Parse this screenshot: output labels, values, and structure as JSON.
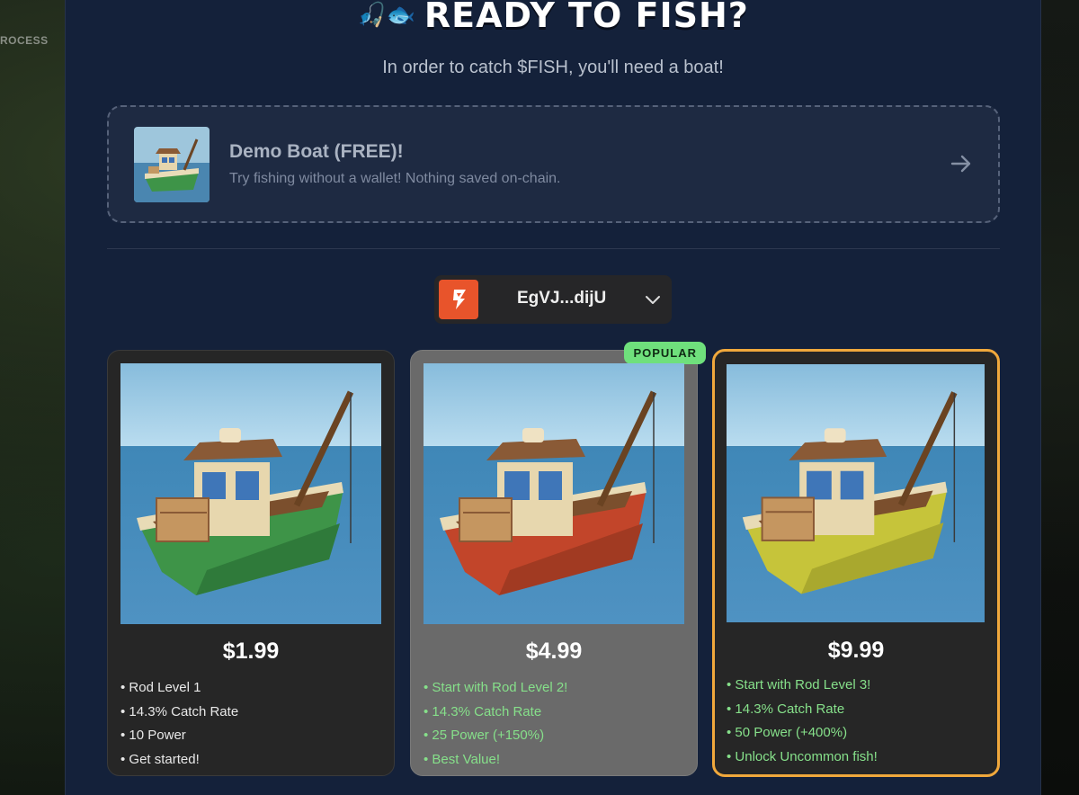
{
  "background": {
    "label": "ROCESS"
  },
  "modal": {
    "title": "READY TO FISH?",
    "title_emoji": "🎣🐟",
    "subtitle": "In order to catch $FISH, you'll need a boat!"
  },
  "demo": {
    "title": "Demo Boat (FREE)!",
    "subtitle": "Try fishing without a wallet! Nothing saved on-chain.",
    "arrow_icon": "arrow-right-icon"
  },
  "wallet": {
    "address": "EgVJ...dijU",
    "logo_icon": "wallet-logo-icon",
    "chevron_icon": "chevron-down-icon"
  },
  "colors": {
    "modal_bg": "#14213a",
    "accent_orange": "#f0a83c",
    "popular_green": "#6fe07c",
    "feature_green": "#86e08a"
  },
  "plans": [
    {
      "price": "$1.99",
      "boat_color": "green",
      "features": [
        "• Rod Level 1",
        "• 14.3% Catch Rate",
        "• 10 Power",
        "• Get started!"
      ]
    },
    {
      "price": "$4.99",
      "badge": "POPULAR",
      "boat_color": "red",
      "features": [
        "• Start with Rod Level 2!",
        "• 14.3% Catch Rate",
        "• 25 Power (+150%)",
        "• Best Value!"
      ]
    },
    {
      "price": "$9.99",
      "boat_color": "yellow",
      "features": [
        "• Start with Rod Level 3!",
        "• 14.3% Catch Rate",
        "• 50 Power (+400%)",
        "• Unlock Uncommon fish!"
      ]
    }
  ]
}
